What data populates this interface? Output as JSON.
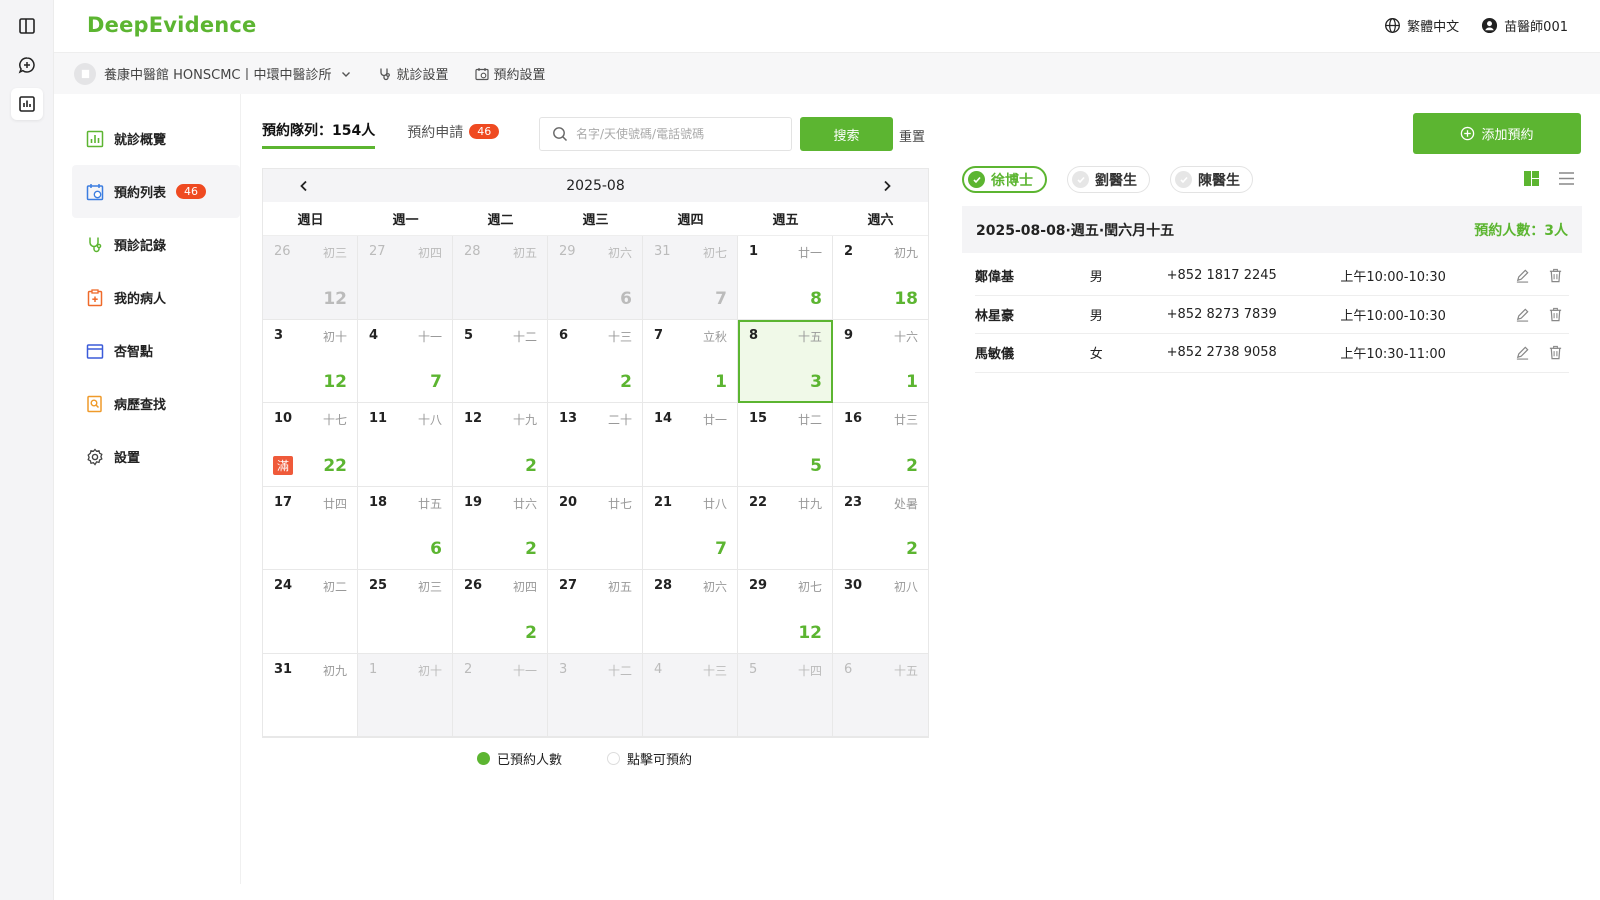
{
  "app": {
    "logo": "DeepEvidence",
    "language": "繁體中文",
    "user": "苗醫師001"
  },
  "subbar": {
    "clinic": "養康中醫館 HONSCMC丨中環中醫診所",
    "consult_settings": "就診設置",
    "booking_settings": "預約設置"
  },
  "sidebar": {
    "items": [
      {
        "label": "就診概覽",
        "icon": "chart-icon"
      },
      {
        "label": "預約列表",
        "icon": "calendar-clock-icon",
        "badge": "46"
      },
      {
        "label": "預診記錄",
        "icon": "stethoscope-icon"
      },
      {
        "label": "我的病人",
        "icon": "clipboard-plus-icon"
      },
      {
        "label": "杏智點",
        "icon": "folder-icon"
      },
      {
        "label": "病歷查找",
        "icon": "search-doc-icon"
      },
      {
        "label": "設置",
        "icon": "gear-icon"
      }
    ]
  },
  "tabs": {
    "queue": "預約隊列：154人",
    "requests": "預約申請",
    "requests_badge": "46"
  },
  "search": {
    "placeholder": "名字/天使號碼/電話號碼",
    "button": "搜索",
    "reset": "重置"
  },
  "add_button": "添加預約",
  "calendar": {
    "month": "2025-08",
    "weekdays": [
      "週日",
      "週一",
      "週二",
      "週三",
      "週四",
      "週五",
      "週六"
    ],
    "days": [
      {
        "d": "26",
        "l": "初三",
        "c": "12",
        "o": true
      },
      {
        "d": "27",
        "l": "初四",
        "c": "",
        "o": true
      },
      {
        "d": "28",
        "l": "初五",
        "c": "",
        "o": true
      },
      {
        "d": "29",
        "l": "初六",
        "c": "6",
        "o": true
      },
      {
        "d": "31",
        "l": "初七",
        "c": "7",
        "o": true
      },
      {
        "d": "1",
        "l": "廿一",
        "c": "8"
      },
      {
        "d": "2",
        "l": "初九",
        "c": "18"
      },
      {
        "d": "3",
        "l": "初十",
        "c": "12"
      },
      {
        "d": "4",
        "l": "十一",
        "c": "7"
      },
      {
        "d": "5",
        "l": "十二",
        "c": ""
      },
      {
        "d": "6",
        "l": "十三",
        "c": "2"
      },
      {
        "d": "7",
        "l": "立秋",
        "c": "1"
      },
      {
        "d": "8",
        "l": "十五",
        "c": "3",
        "sel": true
      },
      {
        "d": "9",
        "l": "十六",
        "c": "1"
      },
      {
        "d": "10",
        "l": "十七",
        "c": "22",
        "full": "滿"
      },
      {
        "d": "11",
        "l": "十八",
        "c": ""
      },
      {
        "d": "12",
        "l": "十九",
        "c": "2"
      },
      {
        "d": "13",
        "l": "二十",
        "c": ""
      },
      {
        "d": "14",
        "l": "廿一",
        "c": ""
      },
      {
        "d": "15",
        "l": "廿二",
        "c": "5"
      },
      {
        "d": "16",
        "l": "廿三",
        "c": "2"
      },
      {
        "d": "17",
        "l": "廿四",
        "c": ""
      },
      {
        "d": "18",
        "l": "廿五",
        "c": "6"
      },
      {
        "d": "19",
        "l": "廿六",
        "c": "2"
      },
      {
        "d": "20",
        "l": "廿七",
        "c": ""
      },
      {
        "d": "21",
        "l": "廿八",
        "c": "7"
      },
      {
        "d": "22",
        "l": "廿九",
        "c": ""
      },
      {
        "d": "23",
        "l": "处暑",
        "c": "2"
      },
      {
        "d": "24",
        "l": "初二",
        "c": ""
      },
      {
        "d": "25",
        "l": "初三",
        "c": ""
      },
      {
        "d": "26",
        "l": "初四",
        "c": "2"
      },
      {
        "d": "27",
        "l": "初五",
        "c": ""
      },
      {
        "d": "28",
        "l": "初六",
        "c": ""
      },
      {
        "d": "29",
        "l": "初七",
        "c": "12"
      },
      {
        "d": "30",
        "l": "初八",
        "c": ""
      },
      {
        "d": "31",
        "l": "初九",
        "c": ""
      },
      {
        "d": "1",
        "l": "初十",
        "c": "",
        "o": true
      },
      {
        "d": "2",
        "l": "十一",
        "c": "",
        "o": true
      },
      {
        "d": "3",
        "l": "十二",
        "c": "",
        "o": true
      },
      {
        "d": "4",
        "l": "十三",
        "c": "",
        "o": true
      },
      {
        "d": "5",
        "l": "十四",
        "c": "",
        "o": true
      },
      {
        "d": "6",
        "l": "十五",
        "c": "",
        "o": true
      }
    ]
  },
  "legend": {
    "booked": "已預約人數",
    "available": "點擊可預約"
  },
  "doctors": [
    "徐博士",
    "劉醫生",
    "陳醫生"
  ],
  "day_panel": {
    "date": "2025-08-08·週五·閏六月十五",
    "count": "預約人數：3人"
  },
  "appointments": [
    {
      "name": "鄭偉基",
      "gender": "男",
      "phone": "+852 1817 2245",
      "time": "上午10:00-10:30"
    },
    {
      "name": "林星豪",
      "gender": "男",
      "phone": "+852 8273 7839",
      "time": "上午10:00-10:30"
    },
    {
      "name": "馬敏儀",
      "gender": "女",
      "phone": "+852 2738 9058",
      "time": "上午10:30-11:00"
    }
  ],
  "colors": {
    "accent": "#5cb531",
    "badge": "#ef4a21"
  }
}
